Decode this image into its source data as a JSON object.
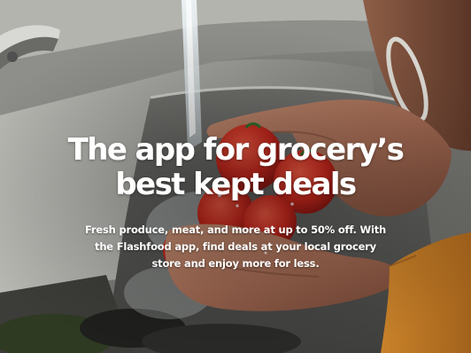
{
  "hero": {
    "title": "The app for grocery’s best kept deals",
    "subtitle": "Fresh produce, meat, and more at up to 50% off. With the Flashfood app, find deals at your local grocery store and enjoy more for less.",
    "background_image": "washing-tomatoes-under-faucet"
  },
  "colors": {
    "text": "#ffffff",
    "sink_steel": "#8c8c89",
    "skin": "#a8725a",
    "tomato": "#c4261c",
    "water": "#d9e4e8"
  }
}
